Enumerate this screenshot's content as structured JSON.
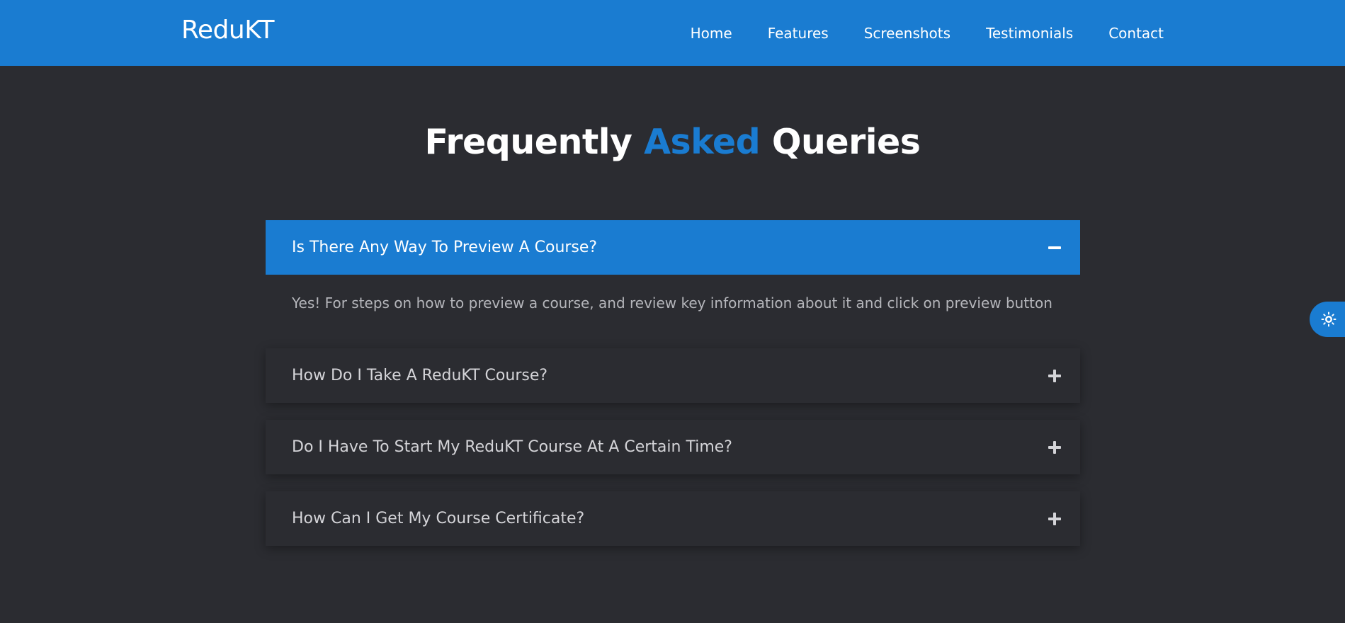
{
  "navbar": {
    "brand": "ReduKT",
    "links": [
      "Home",
      "Features",
      "Screenshots",
      "Testimonials",
      "Contact"
    ]
  },
  "section": {
    "title_part1": "Frequently",
    "title_accent": "Asked",
    "title_part2": "Queries"
  },
  "faq": {
    "items": [
      {
        "question": "Is There Any Way To Preview A Course?",
        "answer": "Yes! For steps on how to preview a course, and review key information about it and click on preview button",
        "expanded": true
      },
      {
        "question": "How Do I Take A ReduKT Course?",
        "expanded": false
      },
      {
        "question": "Do I Have To Start My ReduKT Course At A Certain Time?",
        "expanded": false
      },
      {
        "question": "How Can I Get My Course Certificate?",
        "expanded": false
      }
    ]
  },
  "theme_toggle": {
    "icon": "sun-icon"
  },
  "colors": {
    "primary": "#1a7cd1",
    "background": "#2b2c31",
    "text_light": "#ffffff",
    "text_muted": "#b5b6bb"
  }
}
